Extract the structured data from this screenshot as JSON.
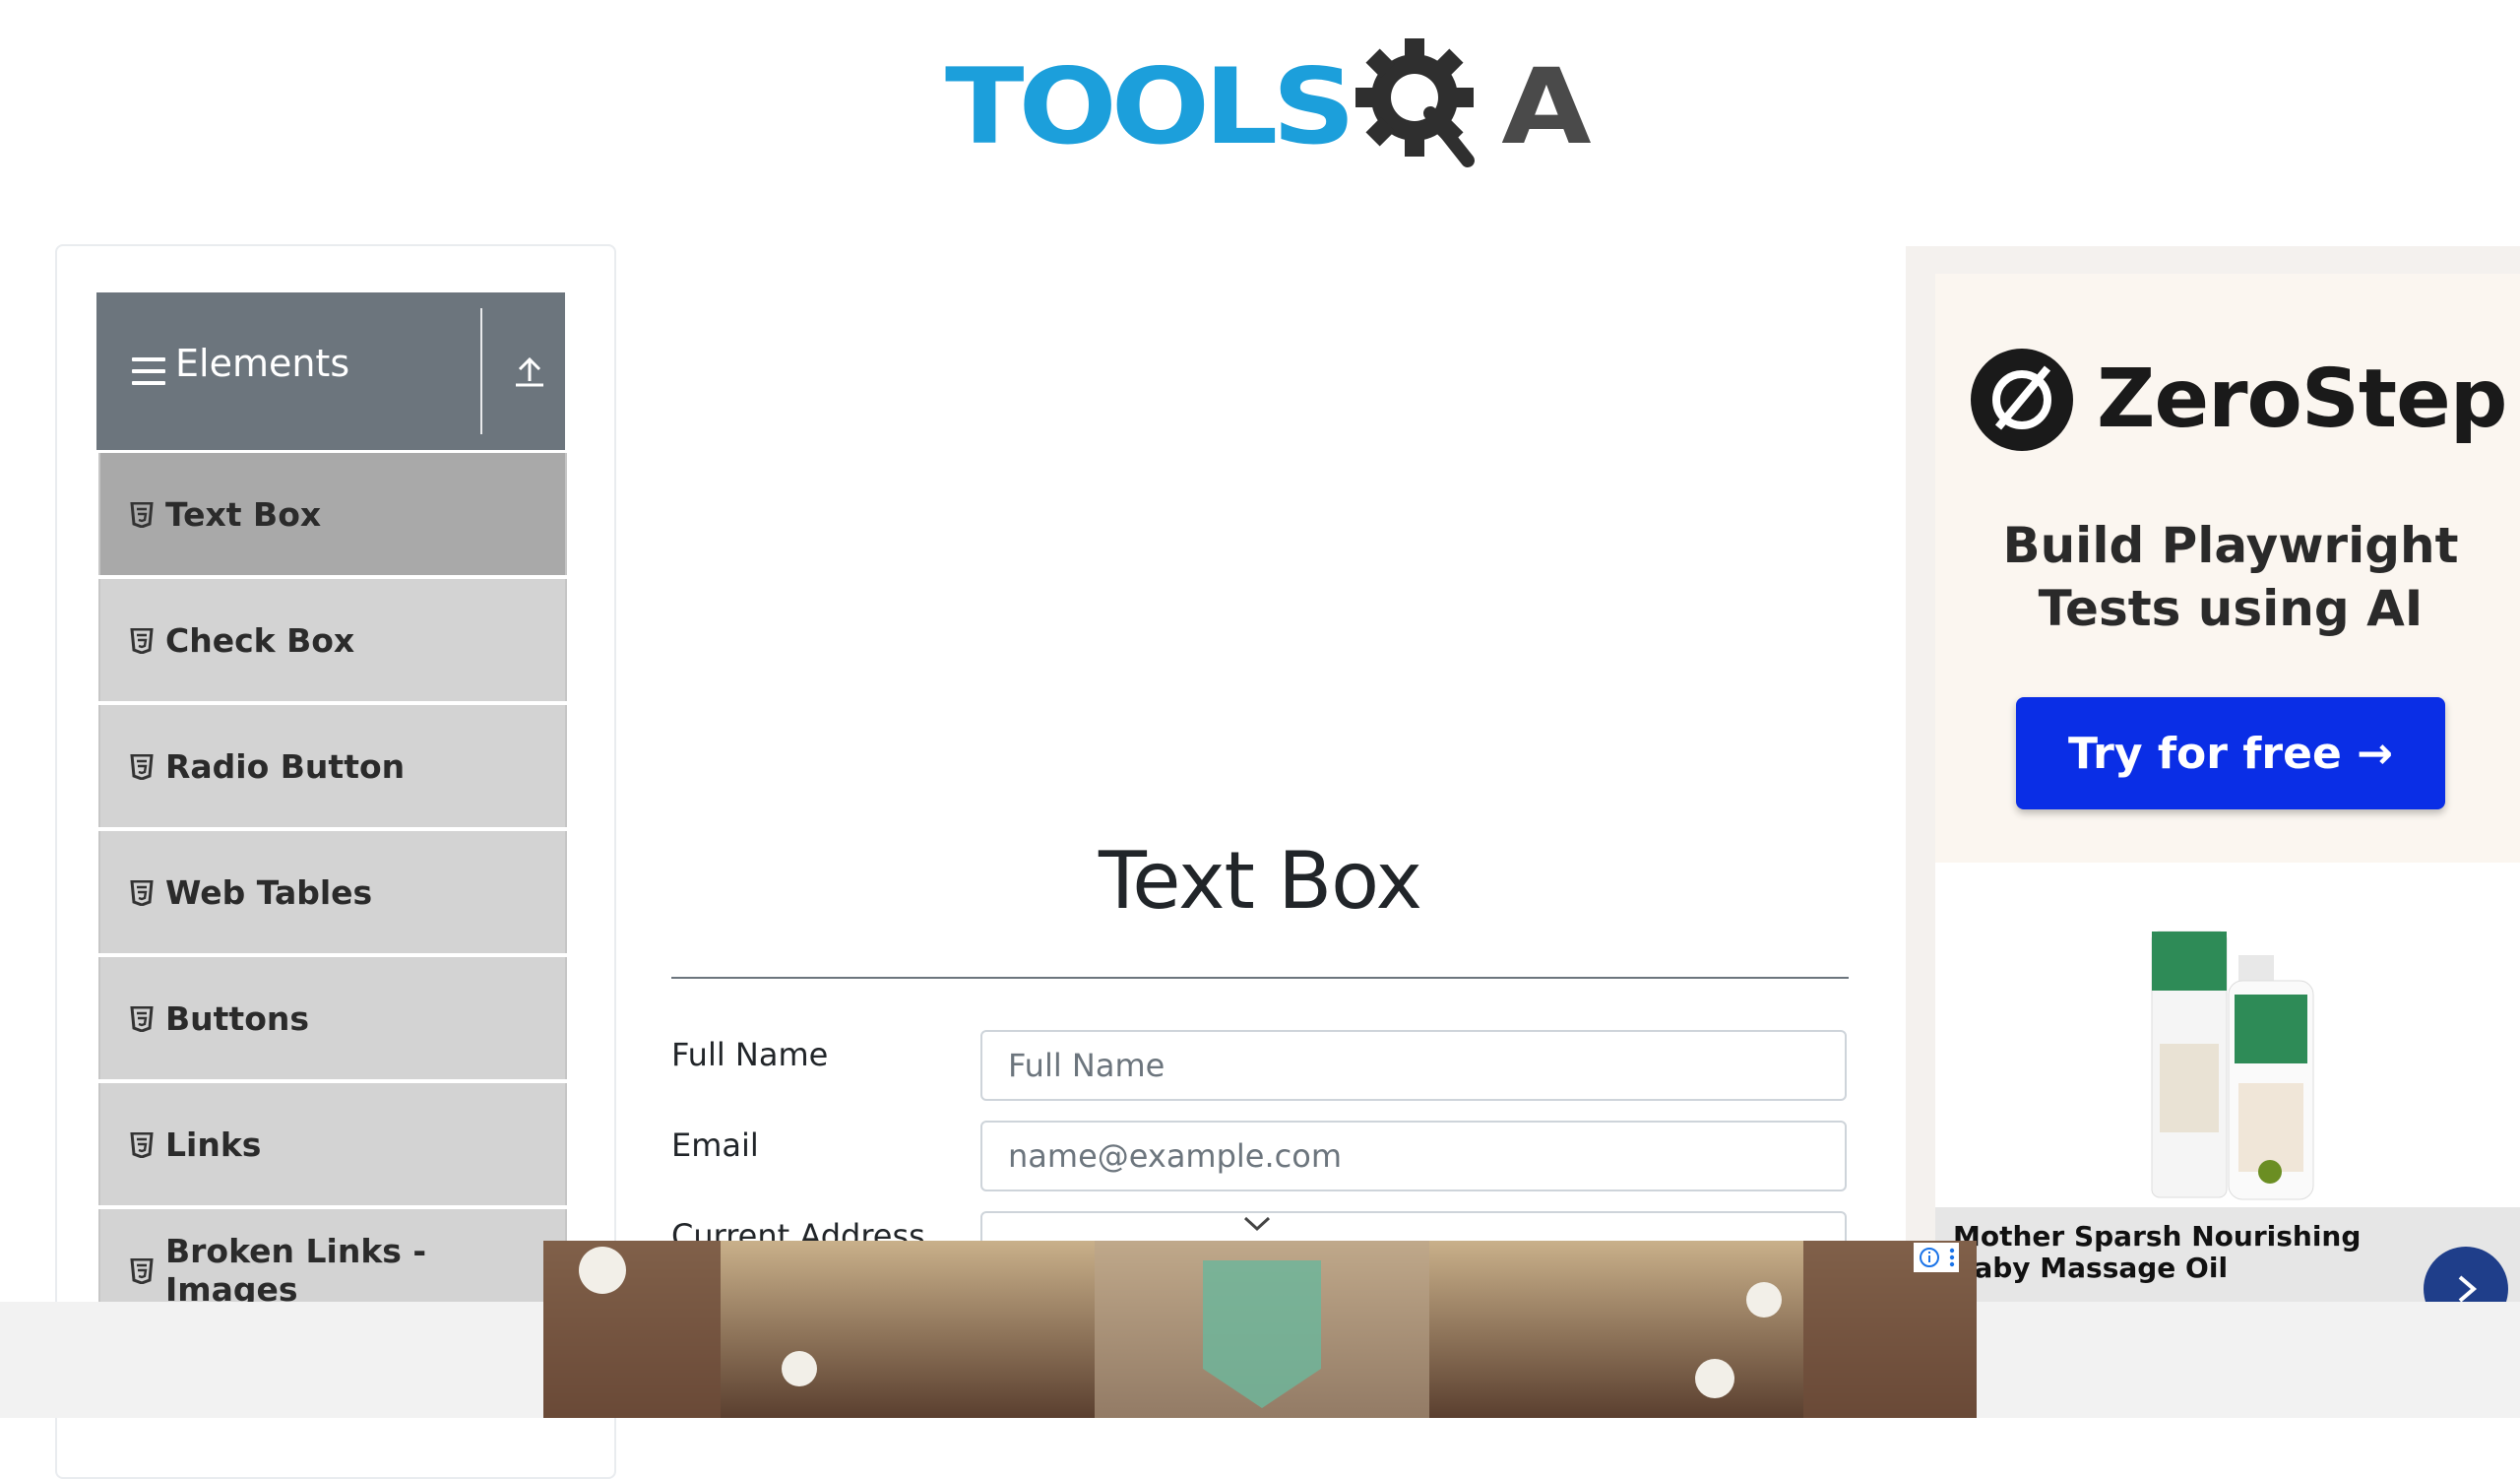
{
  "brand": {
    "logo_text_tools": "TOOLS",
    "logo_text_a": "A"
  },
  "sidebar": {
    "group_title": "Elements",
    "items": [
      {
        "label": "Text Box",
        "active": true
      },
      {
        "label": "Check Box"
      },
      {
        "label": "Radio Button"
      },
      {
        "label": "Web Tables"
      },
      {
        "label": "Buttons"
      },
      {
        "label": "Links"
      },
      {
        "label": "Broken Links - Images"
      }
    ]
  },
  "main": {
    "title": "Text Box",
    "fields": {
      "full_name": {
        "label": "Full Name",
        "placeholder": "Full Name"
      },
      "email": {
        "label": "Email",
        "placeholder": "name@example.com"
      },
      "current_address": {
        "label": "Current Address"
      }
    }
  },
  "ad_right": {
    "brand": "ZeroStep",
    "tagline_line1": "Build Playwright",
    "tagline_line2": "Tests using AI",
    "cta": "Try for free →",
    "product_title": "Mother Sparsh Nourishing Baby Massage Oil"
  },
  "colors": {
    "accent_blue": "#1c9fdb",
    "sidebar_header": "#6c757d",
    "sidebar_item": "#d3d3d3",
    "sidebar_item_active": "#a9a9a9",
    "cta_blue": "#0a2ee6"
  }
}
